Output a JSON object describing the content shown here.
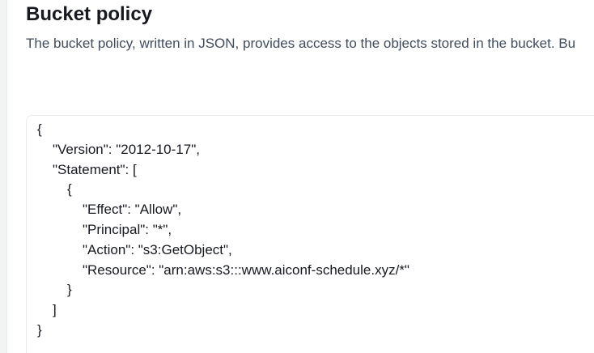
{
  "section": {
    "title": "Bucket policy",
    "description": "The bucket policy, written in JSON, provides access to the objects stored in the bucket. Bu"
  },
  "policy": {
    "lines": [
      "{",
      "\"Version\": \"2012-10-17\",",
      "\"Statement\": [",
      "{",
      "\"Effect\": \"Allow\",",
      "\"Principal\": \"*\",",
      "\"Action\": \"s3:GetObject\",",
      "\"Resource\": \"arn:aws:s3:::www.aiconf-schedule.xyz/*\"",
      "}",
      "]",
      "}"
    ]
  }
}
